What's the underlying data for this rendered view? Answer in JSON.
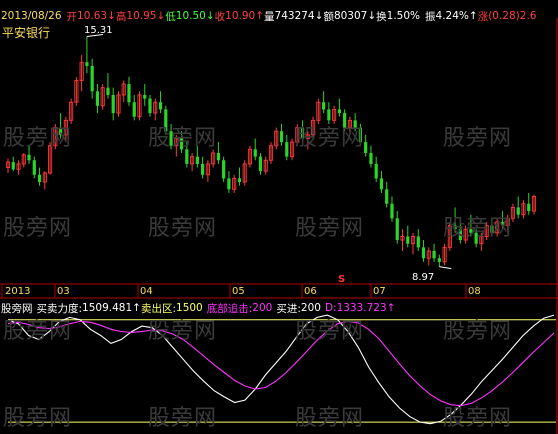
{
  "colors": {
    "background": "#000000",
    "up": "#ff3a3a",
    "down": "#2bd62b",
    "axis": "#b00000",
    "date_text": "#ffdd55",
    "white_line": "#ffffff",
    "magenta_line": "#ff33ff",
    "yellow_line": "#ffff66",
    "watermark": "#3a3a3a"
  },
  "header": {
    "date": "2013/08/26",
    "open_label": "开",
    "open_value": "10.63",
    "high_label": "高",
    "high_value": "10.95",
    "low_label": "低",
    "low_value": "10.50",
    "close_label": "收",
    "close_value": "10.90",
    "volume_label": "量",
    "volume_value": "743274",
    "amount_label": "额",
    "amount_value": "80307",
    "turnover_label": "换",
    "turnover_value": "1.50%",
    "amplitude_label": "振",
    "amplitude_value": "4.24%",
    "change_label": "涨",
    "change_value": "(0.28)2.6"
  },
  "stock_name": "平安银行",
  "price_annotations": {
    "high": "15.31",
    "low": "8.97",
    "signal": "S"
  },
  "months": [
    "2013",
    "03",
    "04",
    "05",
    "06",
    "07",
    "08"
  ],
  "indicator": {
    "name": "股旁网",
    "buy_sell_label": "买卖力度:",
    "buy_sell_value": "1509.481",
    "sell_zone_label": "卖出区:",
    "sell_zone_value": "1500",
    "bottom_label": "底部追击:",
    "bottom_value": "200",
    "buy_label": "买进:",
    "buy_value": "200",
    "d_label": "D:",
    "d_value": "1333.723"
  },
  "watermark": "股旁网",
  "icons": {
    "up_arrow": "arrow-up-icon",
    "down_arrow": "arrow-down-icon"
  },
  "chart_data": [
    {
      "type": "candlestick",
      "title": "平安银行",
      "x_axis_months": [
        "2013",
        "03",
        "04",
        "05",
        "06",
        "07",
        "08"
      ],
      "annotated_high": 15.31,
      "annotated_low": 8.97,
      "ylim": [
        8.6,
        15.6
      ],
      "ohlc": [
        [
          11.7,
          11.95,
          11.55,
          11.85
        ],
        [
          11.85,
          12.0,
          11.6,
          11.65
        ],
        [
          11.65,
          11.9,
          11.5,
          11.8
        ],
        [
          11.8,
          12.1,
          11.7,
          12.05
        ],
        [
          12.05,
          12.3,
          11.8,
          11.9
        ],
        [
          11.9,
          12.0,
          11.4,
          11.5
        ],
        [
          11.5,
          11.7,
          11.2,
          11.3
        ],
        [
          11.3,
          11.6,
          11.1,
          11.55
        ],
        [
          11.55,
          12.4,
          11.5,
          12.3
        ],
        [
          12.3,
          12.9,
          12.2,
          12.8
        ],
        [
          12.8,
          13.2,
          12.5,
          12.6
        ],
        [
          12.6,
          13.1,
          12.4,
          13.0
        ],
        [
          13.0,
          13.6,
          12.9,
          13.5
        ],
        [
          13.5,
          14.2,
          13.4,
          14.1
        ],
        [
          14.1,
          14.8,
          13.8,
          14.6
        ],
        [
          14.6,
          15.31,
          14.3,
          14.5
        ],
        [
          14.5,
          14.7,
          13.6,
          13.8
        ],
        [
          13.8,
          14.0,
          13.2,
          13.4
        ],
        [
          13.4,
          14.0,
          13.3,
          13.9
        ],
        [
          13.9,
          14.3,
          13.6,
          13.7
        ],
        [
          13.7,
          13.9,
          13.0,
          13.2
        ],
        [
          13.2,
          13.8,
          13.1,
          13.7
        ],
        [
          13.7,
          14.1,
          13.5,
          14.0
        ],
        [
          14.0,
          14.2,
          13.4,
          13.5
        ],
        [
          13.5,
          13.7,
          13.0,
          13.1
        ],
        [
          13.1,
          13.8,
          13.0,
          13.7
        ],
        [
          13.7,
          14.0,
          13.4,
          13.6
        ],
        [
          13.6,
          13.7,
          13.1,
          13.2
        ],
        [
          13.2,
          13.6,
          13.0,
          13.5
        ],
        [
          13.5,
          13.8,
          13.2,
          13.3
        ],
        [
          13.3,
          13.4,
          12.6,
          12.7
        ],
        [
          12.7,
          12.9,
          12.2,
          12.3
        ],
        [
          12.3,
          12.6,
          12.0,
          12.5
        ],
        [
          12.5,
          12.7,
          12.1,
          12.2
        ],
        [
          12.2,
          12.4,
          11.7,
          11.8
        ],
        [
          11.8,
          12.1,
          11.6,
          12.0
        ],
        [
          12.0,
          12.3,
          11.7,
          11.8
        ],
        [
          11.8,
          12.0,
          11.4,
          11.5
        ],
        [
          11.5,
          11.9,
          11.3,
          11.8
        ],
        [
          11.8,
          12.2,
          11.7,
          12.1
        ],
        [
          12.1,
          12.4,
          11.8,
          11.9
        ],
        [
          11.9,
          12.0,
          11.3,
          11.4
        ],
        [
          11.4,
          11.6,
          11.0,
          11.1
        ],
        [
          11.1,
          11.5,
          11.0,
          11.4
        ],
        [
          11.4,
          11.7,
          11.2,
          11.3
        ],
        [
          11.3,
          11.9,
          11.2,
          11.8
        ],
        [
          11.8,
          12.3,
          11.7,
          12.2
        ],
        [
          12.2,
          12.5,
          11.9,
          12.0
        ],
        [
          12.0,
          12.1,
          11.5,
          11.6
        ],
        [
          11.6,
          12.0,
          11.5,
          11.9
        ],
        [
          11.9,
          12.4,
          11.8,
          12.3
        ],
        [
          12.3,
          12.8,
          12.2,
          12.7
        ],
        [
          12.7,
          12.9,
          12.3,
          12.4
        ],
        [
          12.4,
          12.6,
          11.9,
          12.0
        ],
        [
          12.0,
          12.5,
          11.9,
          12.4
        ],
        [
          12.4,
          12.9,
          12.3,
          12.8
        ],
        [
          12.8,
          13.0,
          12.4,
          12.5
        ],
        [
          12.5,
          12.7,
          12.2,
          12.6
        ],
        [
          12.6,
          13.1,
          12.5,
          13.0
        ],
        [
          13.0,
          13.6,
          12.9,
          13.5
        ],
        [
          13.5,
          13.8,
          13.2,
          13.3
        ],
        [
          13.3,
          13.5,
          12.9,
          13.0
        ],
        [
          13.0,
          13.4,
          12.9,
          13.3
        ],
        [
          13.3,
          13.6,
          13.1,
          13.2
        ],
        [
          13.2,
          13.3,
          12.7,
          12.8
        ],
        [
          12.8,
          13.1,
          12.6,
          13.0
        ],
        [
          13.0,
          13.2,
          12.7,
          12.8
        ],
        [
          12.8,
          12.9,
          12.3,
          12.4
        ],
        [
          12.4,
          12.6,
          12.0,
          12.1
        ],
        [
          12.1,
          12.3,
          11.7,
          11.8
        ],
        [
          11.8,
          12.0,
          11.3,
          11.4
        ],
        [
          11.4,
          11.6,
          11.0,
          11.1
        ],
        [
          11.1,
          11.3,
          10.6,
          10.7
        ],
        [
          10.7,
          10.9,
          10.2,
          10.3
        ],
        [
          10.3,
          10.5,
          9.6,
          9.7
        ],
        [
          9.7,
          10.0,
          9.4,
          9.8
        ],
        [
          9.8,
          10.1,
          9.5,
          9.6
        ],
        [
          9.6,
          9.9,
          9.3,
          9.8
        ],
        [
          9.8,
          10.0,
          9.4,
          9.5
        ],
        [
          9.5,
          9.7,
          9.1,
          9.2
        ],
        [
          9.2,
          9.5,
          9.0,
          9.4
        ],
        [
          9.4,
          9.6,
          9.1,
          9.2
        ],
        [
          9.2,
          9.3,
          8.97,
          9.1
        ],
        [
          9.1,
          9.6,
          9.0,
          9.5
        ],
        [
          9.5,
          10.2,
          9.4,
          10.1
        ],
        [
          10.1,
          10.6,
          9.9,
          10.0
        ],
        [
          10.0,
          10.3,
          9.6,
          9.7
        ],
        [
          9.7,
          10.1,
          9.6,
          10.0
        ],
        [
          10.0,
          10.4,
          9.8,
          9.9
        ],
        [
          9.9,
          10.0,
          9.5,
          9.6
        ],
        [
          9.6,
          9.9,
          9.4,
          9.8
        ],
        [
          9.8,
          10.2,
          9.7,
          10.1
        ],
        [
          10.1,
          10.3,
          9.8,
          9.9
        ],
        [
          9.9,
          10.3,
          9.8,
          10.2
        ],
        [
          10.2,
          10.5,
          10.0,
          10.1
        ],
        [
          10.1,
          10.4,
          9.9,
          10.3
        ],
        [
          10.3,
          10.7,
          10.2,
          10.6
        ],
        [
          10.6,
          10.9,
          10.3,
          10.4
        ],
        [
          10.4,
          10.8,
          10.3,
          10.7
        ],
        [
          10.7,
          11.0,
          10.4,
          10.5
        ],
        [
          10.5,
          10.95,
          10.4,
          10.9
        ]
      ]
    },
    {
      "type": "line",
      "title": "股旁网",
      "series": [
        {
          "name": "买卖力度",
          "values": [
            1500,
            1450,
            1300,
            1250,
            1350,
            1480,
            1530,
            1500,
            1380,
            1300,
            1200,
            1250,
            1350,
            1420,
            1400,
            1300,
            1150,
            1000,
            850,
            720,
            600,
            520,
            450,
            480,
            620,
            800,
            950,
            1100,
            1280,
            1450,
            1530,
            1560,
            1500,
            1350,
            1150,
            900,
            700,
            520,
            380,
            270,
            200,
            180,
            210,
            300,
            420,
            560,
            720,
            860,
            1000,
            1150,
            1300,
            1420,
            1520,
            1560
          ]
        },
        {
          "name": "D",
          "values": [
            1450,
            1470,
            1440,
            1400,
            1390,
            1410,
            1450,
            1480,
            1470,
            1430,
            1380,
            1350,
            1340,
            1350,
            1370,
            1360,
            1320,
            1250,
            1150,
            1040,
            930,
            830,
            730,
            660,
            620,
            640,
            720,
            830,
            960,
            1100,
            1240,
            1360,
            1450,
            1480,
            1460,
            1380,
            1260,
            1100,
            940,
            790,
            660,
            550,
            470,
            420,
            410,
            440,
            510,
            600,
            710,
            830,
            960,
            1090,
            1210,
            1333.723
          ]
        }
      ],
      "reference_lines": [
        1500,
        200
      ]
    }
  ]
}
